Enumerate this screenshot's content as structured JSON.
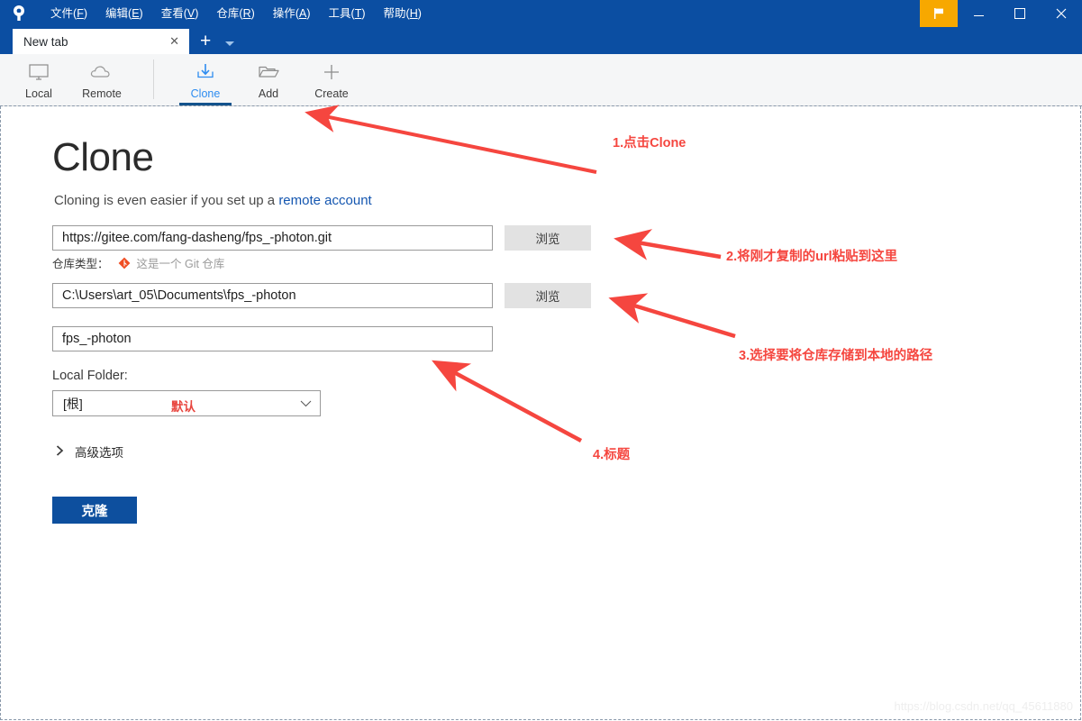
{
  "window": {
    "app_logo_icon": "sourcetree-logo-icon",
    "menus": [
      {
        "label": "文件",
        "accel": "F"
      },
      {
        "label": "编辑",
        "accel": "E"
      },
      {
        "label": "查看",
        "accel": "V"
      },
      {
        "label": "仓库",
        "accel": "R"
      },
      {
        "label": "操作",
        "accel": "A"
      },
      {
        "label": "工具",
        "accel": "T"
      },
      {
        "label": "帮助",
        "accel": "H"
      }
    ],
    "controls": {
      "flag_icon": "flag-icon",
      "minimize_icon": "minimize-icon",
      "maximize_icon": "maximize-icon",
      "close_icon": "close-icon"
    },
    "accent_blue": "#0b4ea2",
    "flag_orange": "#f7a800"
  },
  "tabs": {
    "items": [
      {
        "label": "New tab",
        "close_icon": "close-icon"
      }
    ],
    "add_icon": "plus-icon",
    "dropdown_icon": "chevron-down-icon"
  },
  "toolbar": {
    "items": [
      {
        "label": "Local",
        "icon": "monitor-icon",
        "active": false
      },
      {
        "label": "Remote",
        "icon": "cloud-icon",
        "active": false
      },
      {
        "label": "Clone",
        "icon": "clone-download-icon",
        "active": true
      },
      {
        "label": "Add",
        "icon": "folder-open-icon",
        "active": false
      },
      {
        "label": "Create",
        "icon": "plus-icon",
        "active": false
      }
    ],
    "active_color": "#2d8cf0",
    "underline_color": "#13538c"
  },
  "main": {
    "heading": "Clone",
    "subtitle_prefix": "Cloning is even easier if you set up a ",
    "subtitle_link": "remote account",
    "source_url": "https://gitee.com/fang-dasheng/fps_-photon.git",
    "destination_path": "C:\\Users\\art_05\\Documents\\fps_-photon",
    "repo_name": "fps_-photon",
    "browse_label": "浏览",
    "repo_type_label": "仓库类型：",
    "repo_type_icon": "git-diamond-icon",
    "repo_type_value": "这是一个 Git 仓库",
    "local_folder_label": "Local Folder:",
    "local_folder_value": "[根]",
    "local_folder_note": "默认",
    "local_folder_chevron_icon": "chevron-down-icon",
    "advanced_label": "高级选项",
    "advanced_chevron_icon": "chevron-right-icon",
    "clone_button_label": "克隆"
  },
  "annotations": {
    "color": "#f5463f",
    "items": [
      {
        "id": "anno-1",
        "text": "1.点击Clone"
      },
      {
        "id": "anno-2",
        "text": "2.将刚才复制的url粘贴到这里"
      },
      {
        "id": "anno-3",
        "text": "3.选择要将仓库存储到本地的路径"
      },
      {
        "id": "anno-4",
        "text": "4.标题"
      }
    ]
  },
  "watermark": {
    "text": "https://blog.csdn.net/qq_45611880"
  }
}
